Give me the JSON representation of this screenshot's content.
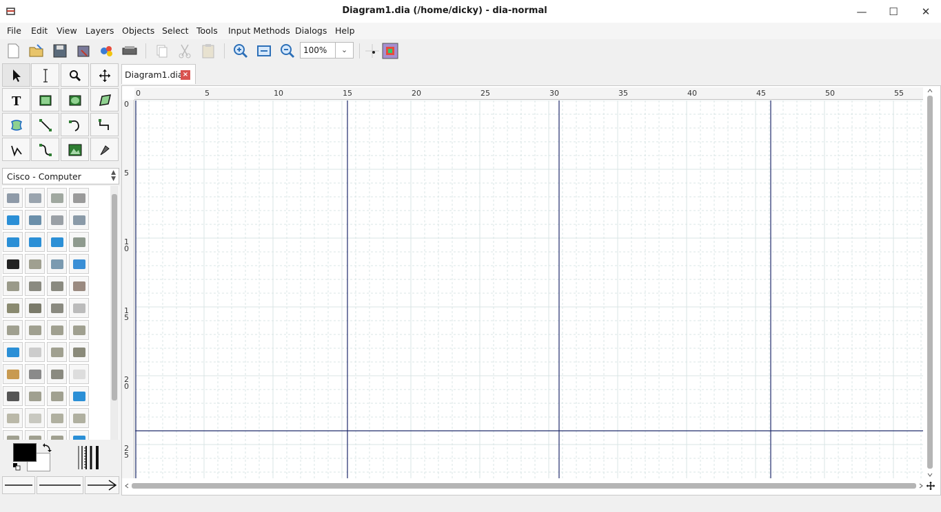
{
  "window": {
    "title": "Diagram1.dia (/home/dicky) - dia-normal",
    "minimize_icon": "minimize-icon",
    "maximize_icon": "maximize-icon",
    "close_icon": "close-icon"
  },
  "menu": [
    "File",
    "Edit",
    "View",
    "Layers",
    "Objects",
    "Select",
    "Tools",
    "Input Methods",
    "Dialogs",
    "Help"
  ],
  "toolbar": {
    "zoom_value": "100%",
    "buttons": [
      "new-document-icon",
      "open-folder-icon",
      "save-icon",
      "save-as-icon",
      "print-icon",
      "export-icon",
      "copy-icon",
      "cut-icon",
      "paste-icon",
      "zoom-in-icon",
      "zoom-fit-icon",
      "zoom-out-icon",
      "snap-to-grid-icon",
      "snap-to-objects-icon"
    ]
  },
  "tools": [
    "pointer",
    "text-edit",
    "magnify",
    "scroll",
    "text",
    "box",
    "ellipse",
    "polygon",
    "beziergon",
    "line",
    "arc",
    "zigzag-line",
    "polyline",
    "bezier-line",
    "image",
    "outline"
  ],
  "sheet": {
    "selected": "Cisco - Computer"
  },
  "tab": {
    "label": "Diagram1.dia",
    "close": "×"
  },
  "ruler": {
    "h_labels": [
      "0",
      "5",
      "10",
      "15",
      "20",
      "25",
      "30",
      "35",
      "40",
      "45",
      "50",
      "55"
    ],
    "v_labels": [
      "0",
      "5",
      "1\n0",
      "1\n5",
      "2\n0",
      "2\n5"
    ]
  },
  "colors": {
    "foreground": "#000000",
    "background": "#ffffff",
    "page_break": "#1f2a6b",
    "grid": "#d8e4e4"
  }
}
